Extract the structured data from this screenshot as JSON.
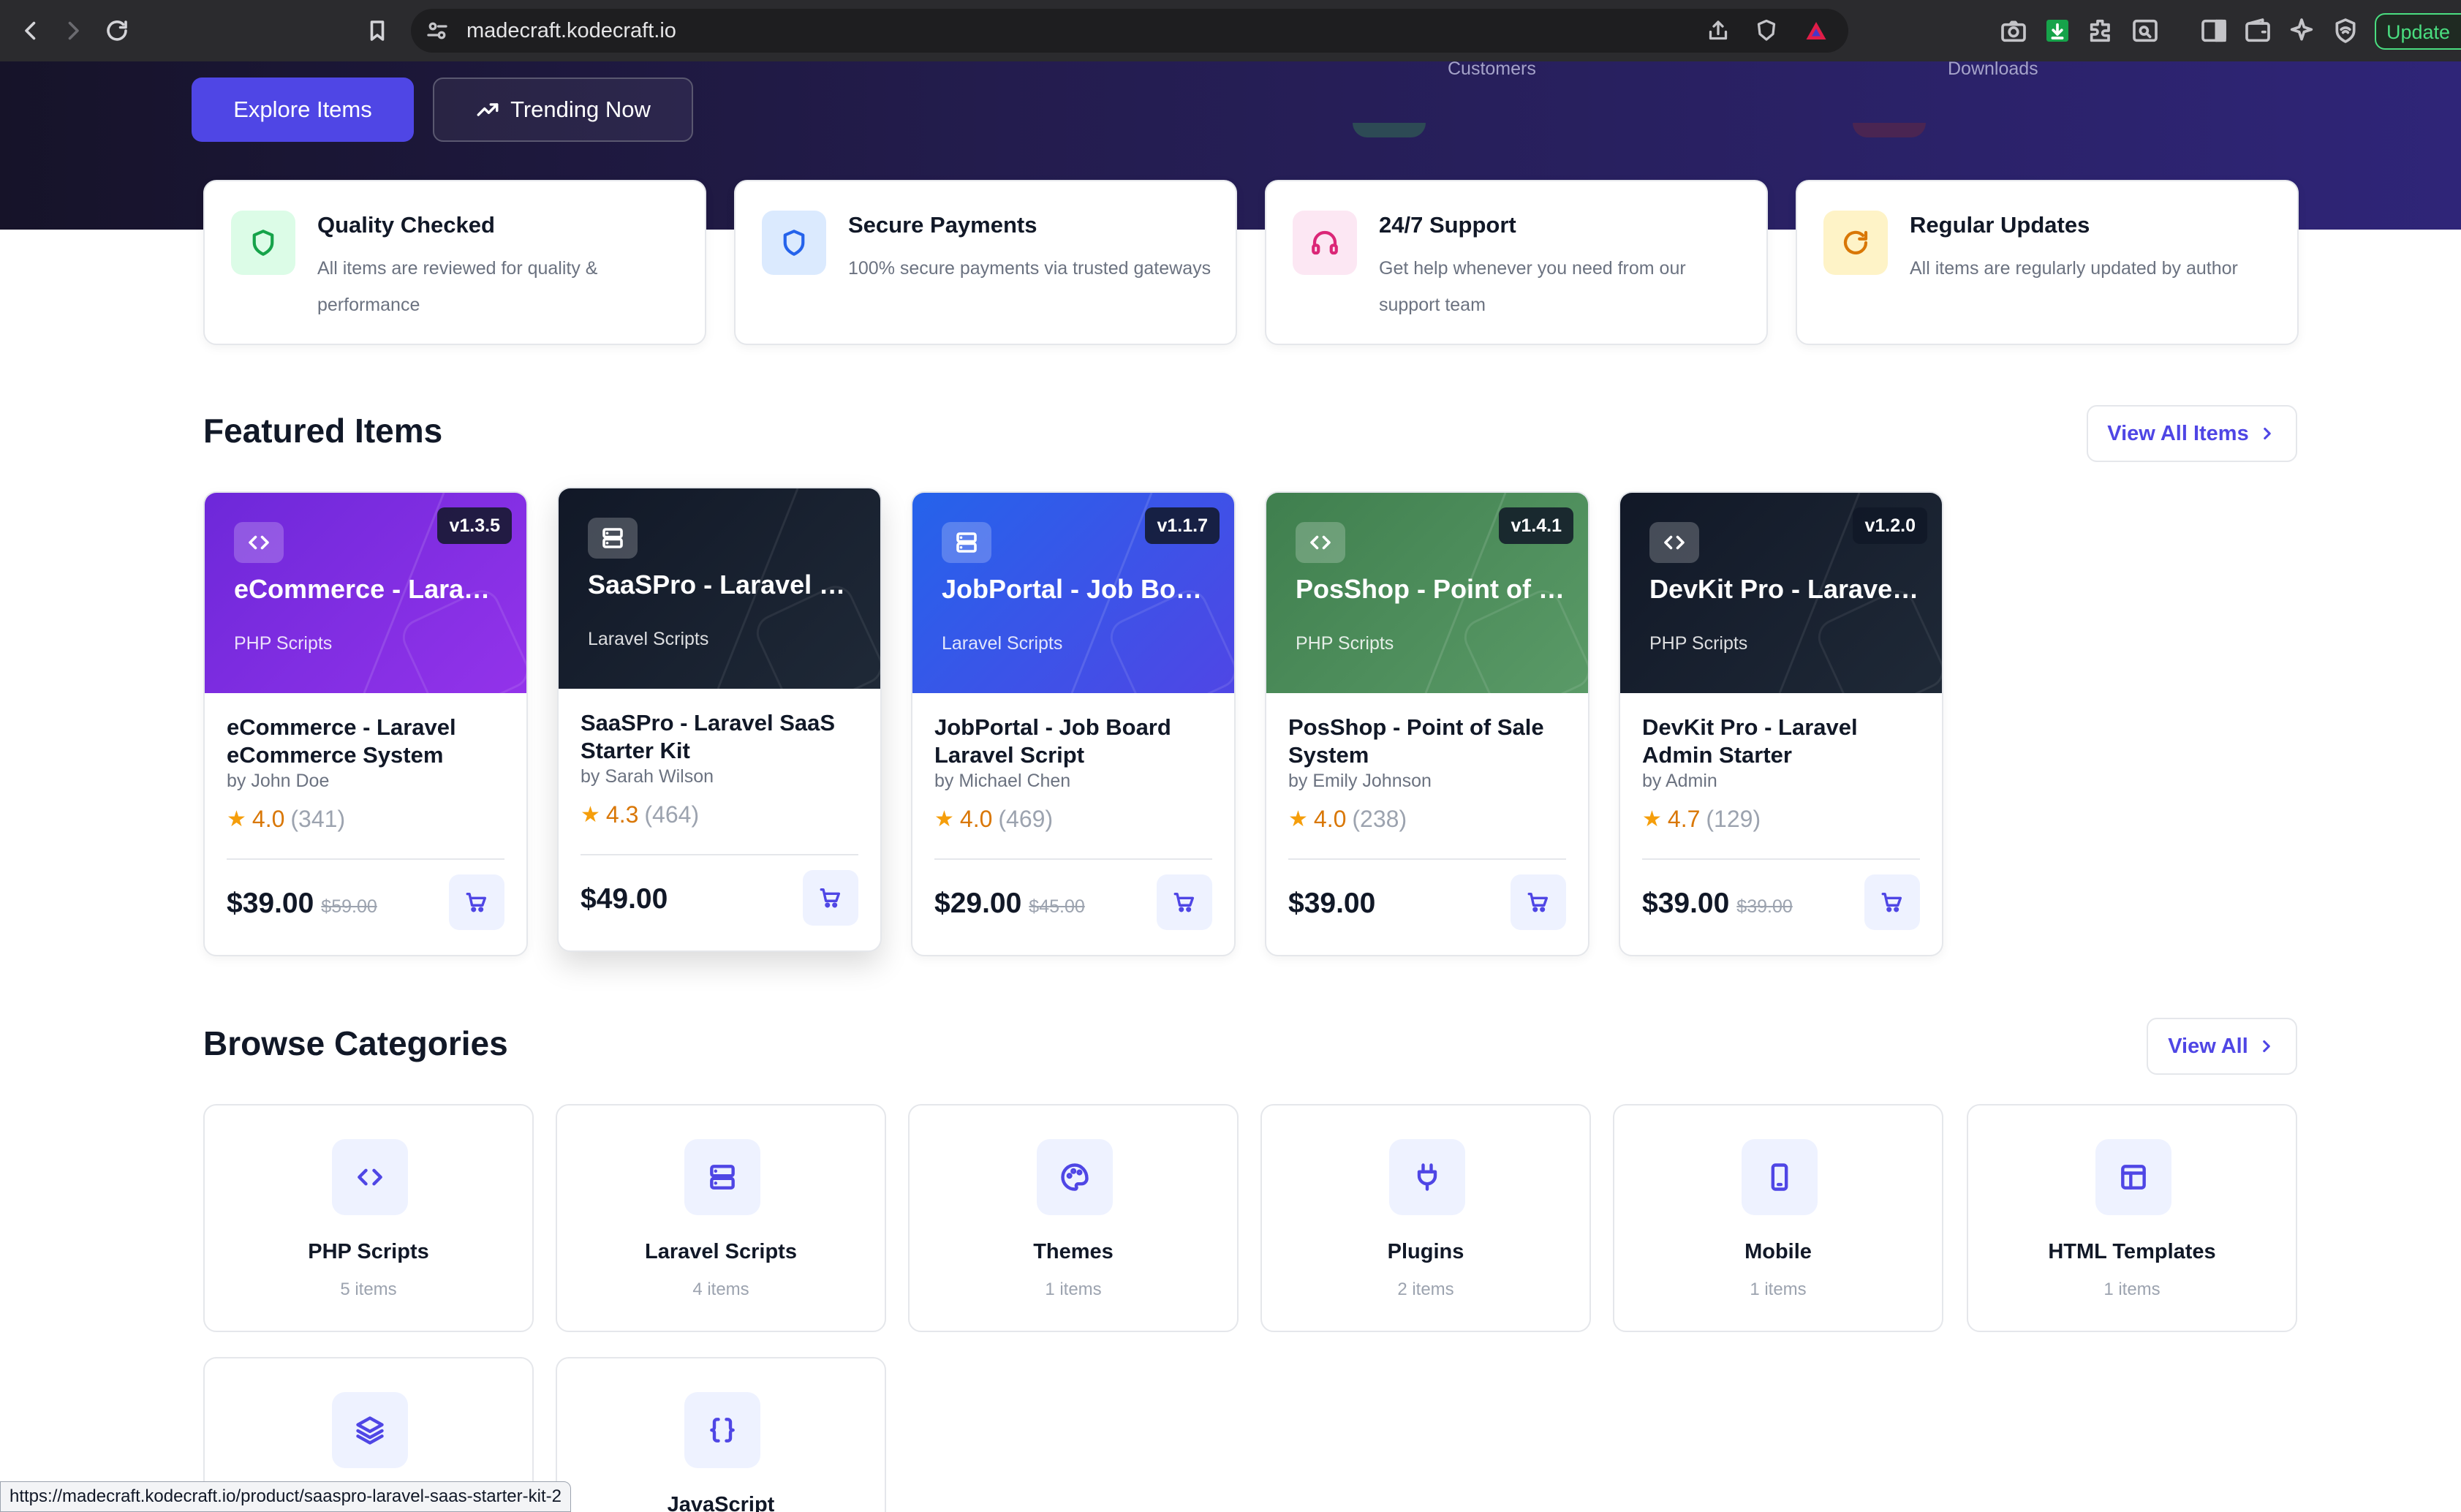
{
  "browser": {
    "url": "madecraft.kodecraft.io",
    "update_label": "Update"
  },
  "hero": {
    "stat_customers_label": "Customers",
    "stat_downloads_label": "Downloads",
    "explore_label": "Explore Items",
    "trending_label": "Trending Now"
  },
  "features": [
    {
      "title": "Quality Checked",
      "desc": "All items are reviewed for quality & performance",
      "icon": "shield-check-icon",
      "color": "#16a34a",
      "bg": "#dcfce7"
    },
    {
      "title": "Secure Payments",
      "desc": "100% secure payments via trusted gateways",
      "icon": "shield-icon",
      "color": "#2563eb",
      "bg": "#dbeafe"
    },
    {
      "title": "24/7 Support",
      "desc": "Get help whenever you need from our support team",
      "icon": "headphones-icon",
      "color": "#db2777",
      "bg": "#fce7f3"
    },
    {
      "title": "Regular Updates",
      "desc": "All items are regularly updated by author",
      "icon": "refresh-icon",
      "color": "#d97706",
      "bg": "#fef3c7"
    }
  ],
  "featured": {
    "title": "Featured Items",
    "view_all_label": "View All Items",
    "items": [
      {
        "banner_title": "eCommerce - Laravel eCommerce System",
        "category": "PHP Scripts",
        "version": "v1.3.5",
        "name": "eCommerce - Laravel eCommerce System",
        "author": "by John Doe",
        "rating": "4.0",
        "reviews": "(341)",
        "price": "$39.00",
        "old_price": "$59.00",
        "icon": "code-icon",
        "gradient_from": "#6d28d9",
        "gradient_to": "#9333ea"
      },
      {
        "banner_title": "SaaSPro - Laravel SaaS Starter Kit",
        "category": "Laravel Scripts",
        "version": "",
        "name": "SaaSPro - Laravel SaaS Starter Kit",
        "author": "by Sarah Wilson",
        "rating": "4.3",
        "reviews": "(464)",
        "price": "$49.00",
        "old_price": "",
        "icon": "server-icon",
        "gradient_from": "#111827",
        "gradient_to": "#1f2937"
      },
      {
        "banner_title": "JobPortal - Job Board Laravel Script",
        "category": "Laravel Scripts",
        "version": "v1.1.7",
        "name": "JobPortal - Job Board Laravel Script",
        "author": "by Michael Chen",
        "rating": "4.0",
        "reviews": "(469)",
        "price": "$29.00",
        "old_price": "$45.00",
        "icon": "server-icon",
        "gradient_from": "#2563eb",
        "gradient_to": "#4f46e5"
      },
      {
        "banner_title": "PosShop - Point of Sale System",
        "category": "PHP Scripts",
        "version": "v1.4.1",
        "name": "PosShop - Point of Sale System",
        "author": "by Emily Johnson",
        "rating": "4.0",
        "reviews": "(238)",
        "price": "$39.00",
        "old_price": "",
        "icon": "code-icon",
        "gradient_from": "#3f7f4e",
        "gradient_to": "#5a9a67"
      },
      {
        "banner_title": "DevKit Pro - Laravel Admin Starter",
        "category": "PHP Scripts",
        "version": "v1.2.0",
        "name": "DevKit Pro - Laravel Admin Starter",
        "author": "by Admin",
        "rating": "4.7",
        "reviews": "(129)",
        "price": "$39.00",
        "old_price": "$39.00",
        "icon": "code-icon",
        "gradient_from": "#111827",
        "gradient_to": "#1f2937"
      }
    ]
  },
  "categories": {
    "title": "Browse Categories",
    "view_all_label": "View All",
    "items": [
      {
        "name": "PHP Scripts",
        "count": "5 items",
        "icon": "code-icon"
      },
      {
        "name": "Laravel Scripts",
        "count": "4 items",
        "icon": "server-icon"
      },
      {
        "name": "Themes",
        "count": "1 items",
        "icon": "palette-icon"
      },
      {
        "name": "Plugins",
        "count": "2 items",
        "icon": "plug-icon"
      },
      {
        "name": "Mobile",
        "count": "1 items",
        "icon": "smartphone-icon"
      },
      {
        "name": "HTML Templates",
        "count": "1 items",
        "icon": "layout-icon"
      },
      {
        "name": "",
        "count": "",
        "icon": "layers-icon"
      },
      {
        "name": "JavaScript",
        "count": "",
        "icon": "braces-icon"
      }
    ]
  },
  "status_url": "https://madecraft.kodecraft.io/product/saaspro-laravel-saas-starter-kit-2"
}
